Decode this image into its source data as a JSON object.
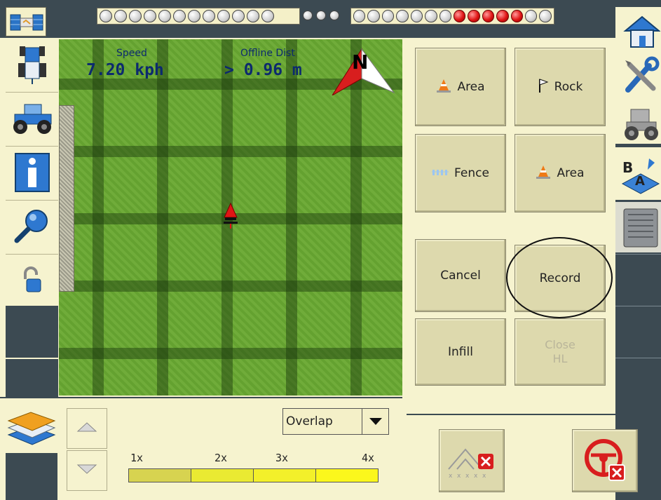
{
  "topbar": {
    "lightbar_left_leds": [
      "off",
      "off",
      "off",
      "off",
      "off",
      "off",
      "off",
      "off",
      "off",
      "off",
      "off",
      "off"
    ],
    "center_leds": [
      "off",
      "off",
      "off"
    ],
    "lightbar_right_leds": [
      "off",
      "off",
      "off",
      "off",
      "off",
      "off",
      "off",
      "red",
      "red",
      "red",
      "red",
      "red",
      "off",
      "off"
    ],
    "colors": {
      "led_red": "#e01515",
      "bar_bg": "#3c4a52"
    }
  },
  "map": {
    "speed_label": "Speed",
    "speed_value": "7.20 kph",
    "offline_label": "Offline Dist",
    "offline_value": "> 0.96 m",
    "compass_letter": "N"
  },
  "panel": {
    "area1_label": "Area",
    "rock_label": "Rock",
    "fence_label": "Fence",
    "area2_label": "Area",
    "cancel_label": "Cancel",
    "record_label": "Record",
    "infill_label": "Infill",
    "close_hl_line1": "Close",
    "close_hl_line2": "HL"
  },
  "bottom": {
    "overlap_select_value": "Overlap",
    "scale_labels": [
      "1x",
      "2x",
      "3x",
      "4x"
    ],
    "scale_colors": [
      "#d7d350",
      "#eaea32",
      "#f3f02a",
      "#fbf71c"
    ]
  },
  "icons": {
    "left_toolbar": [
      "tractor-guidance-icon",
      "tractor-icon",
      "info-icon",
      "search-icon",
      "unlock-icon"
    ],
    "right_strip": [
      "home-icon",
      "tools-icon",
      "vehicle-icon",
      "ab-line-icon",
      "controller-box-icon"
    ]
  }
}
